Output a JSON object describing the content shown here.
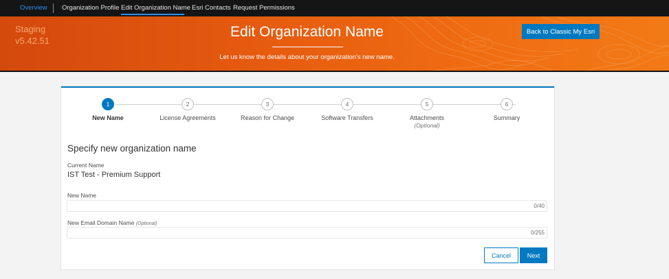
{
  "nav": {
    "items": [
      {
        "label": "Overview"
      },
      {
        "label": "Organization Profile"
      },
      {
        "label": "Edit Organization Name"
      },
      {
        "label": "Esri Contacts"
      },
      {
        "label": "Request Permissions"
      }
    ]
  },
  "hero": {
    "env": "Staging",
    "version": "v5.42.51",
    "title": "Edit Organization Name",
    "subtitle": "Let us know the details about your organization's new name.",
    "classic_button": "Back to Classic My Esri"
  },
  "stepper": {
    "active_step": 1,
    "steps": [
      {
        "number": "1",
        "label": "New Name"
      },
      {
        "number": "2",
        "label": "License Agreements"
      },
      {
        "number": "3",
        "label": "Reason for Change"
      },
      {
        "number": "4",
        "label": "Software Transfers"
      },
      {
        "number": "5",
        "label": "Attachments",
        "sub": "(Optional)"
      },
      {
        "number": "6",
        "label": "Summary"
      }
    ]
  },
  "form": {
    "title": "Specify new organization name",
    "current_name_label": "Current Name",
    "current_name_value": "IST Test - Premium Support",
    "new_name_label": "New Name",
    "new_name_counter": "0/40",
    "email_domain_label": "New Email Domain Name",
    "email_domain_optional": "(Optional)",
    "email_domain_counter": "0/255",
    "cancel_label": "Cancel",
    "next_label": "Next"
  },
  "colors": {
    "accent": "#0079c1",
    "nav_link": "#2d8ef2",
    "hero_orange": "#ef6c12",
    "nav_bg": "#151515"
  }
}
